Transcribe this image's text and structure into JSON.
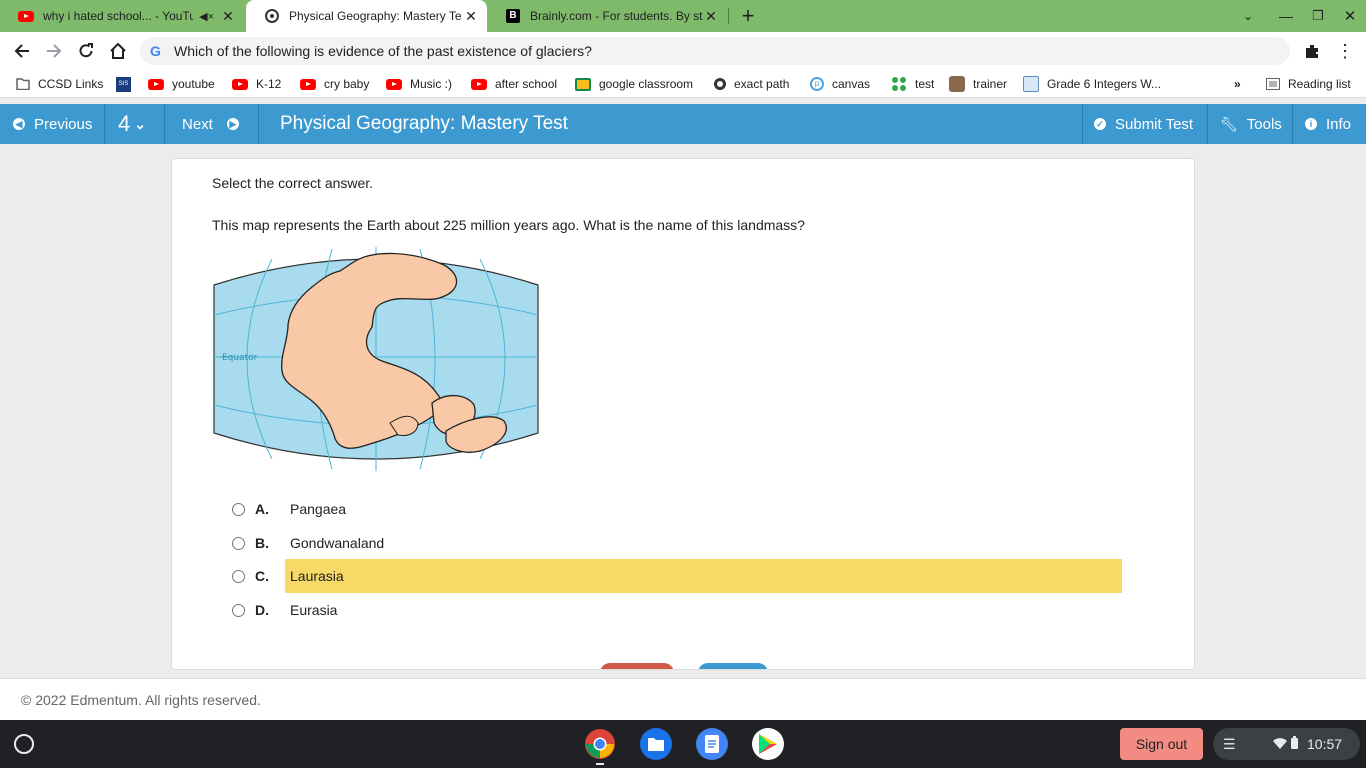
{
  "browser": {
    "tabs": [
      {
        "title": "why i hated school... - YouTu",
        "icon": "youtube-icon",
        "muted": true
      },
      {
        "title": "Physical Geography: Mastery Te",
        "icon": "edmentum-icon",
        "active": true
      },
      {
        "title": "Brainly.com - For students. By st",
        "icon": "brainly-icon"
      }
    ],
    "omnibox_text": "Which of the following is evidence of the past existence of glaciers?",
    "bookmarks": [
      {
        "label": "CCSD Links",
        "icon": "folder-icon"
      },
      {
        "label": "",
        "icon": "sis-icon",
        "badge": "SIS"
      },
      {
        "label": "youtube",
        "icon": "youtube-icon"
      },
      {
        "label": "K-12",
        "icon": "youtube-icon"
      },
      {
        "label": "cry baby",
        "icon": "youtube-icon"
      },
      {
        "label": "Music :)",
        "icon": "youtube-icon"
      },
      {
        "label": "after school",
        "icon": "youtube-icon"
      },
      {
        "label": "google classroom",
        "icon": "classroom-icon"
      },
      {
        "label": "exact path",
        "icon": "exact-path-icon"
      },
      {
        "label": "canvas",
        "icon": "canvas-icon"
      },
      {
        "label": "test",
        "icon": "test-icon"
      },
      {
        "label": "trainer",
        "icon": "trainer-icon"
      },
      {
        "label": "Grade 6 Integers W...",
        "icon": "worksheet-icon"
      }
    ],
    "overflow": "»",
    "reading_list": "Reading list"
  },
  "appbar": {
    "previous": "Previous",
    "question_number": "4",
    "next": "Next",
    "title": "Physical Geography: Mastery Test",
    "submit": "Submit Test",
    "tools": "Tools",
    "info": "Info"
  },
  "question": {
    "instruction": "Select the correct answer.",
    "text": "This map represents the Earth about 225 million years ago. What is the name of this landmass?",
    "map_label": "Equator",
    "options": [
      {
        "letter": "A.",
        "text": "Pangaea"
      },
      {
        "letter": "B.",
        "text": "Gondwanaland"
      },
      {
        "letter": "C.",
        "text": "Laurasia",
        "highlighted": true
      },
      {
        "letter": "D.",
        "text": "Eurasia"
      }
    ]
  },
  "footer": {
    "copyright": "© 2022 Edmentum. All rights reserved."
  },
  "shelf": {
    "sign_out": "Sign out",
    "time": "10:57"
  },
  "colors": {
    "appbar": "#3d9ad1",
    "highlight": "#f6d966",
    "tabstrip": "#7fba6b",
    "signout": "#f28b82"
  }
}
